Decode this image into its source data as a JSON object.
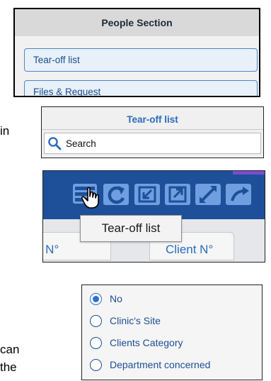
{
  "fragments": {
    "left_in": "in",
    "left_can": "can",
    "left_the": "the"
  },
  "people_panel": {
    "title": "People Section",
    "buttons": [
      {
        "label": "Tear-off list"
      },
      {
        "label": "Files & Request"
      }
    ]
  },
  "tearoff_panel": {
    "title": "Tear-off list",
    "search_label": "Search"
  },
  "toolbar_panel": {
    "icons": [
      "tear-off-list-icon",
      "refresh-icon",
      "import-icon",
      "export-icon",
      "expand-icon",
      "share-icon"
    ],
    "tooltip": "Tear-off list",
    "tabs": [
      {
        "label": "e N°"
      },
      {
        "label": "Client N°"
      }
    ]
  },
  "radio_panel": {
    "options": [
      {
        "label": "No",
        "selected": true
      },
      {
        "label": "Clinic's Site",
        "selected": false
      },
      {
        "label": "Clients Category",
        "selected": false
      },
      {
        "label": "Department concerned",
        "selected": false
      }
    ]
  },
  "colors": {
    "toolbar_blue": "#1e4f99",
    "accent_blue": "#2a6bbd",
    "button_border": "#4d86c6"
  }
}
